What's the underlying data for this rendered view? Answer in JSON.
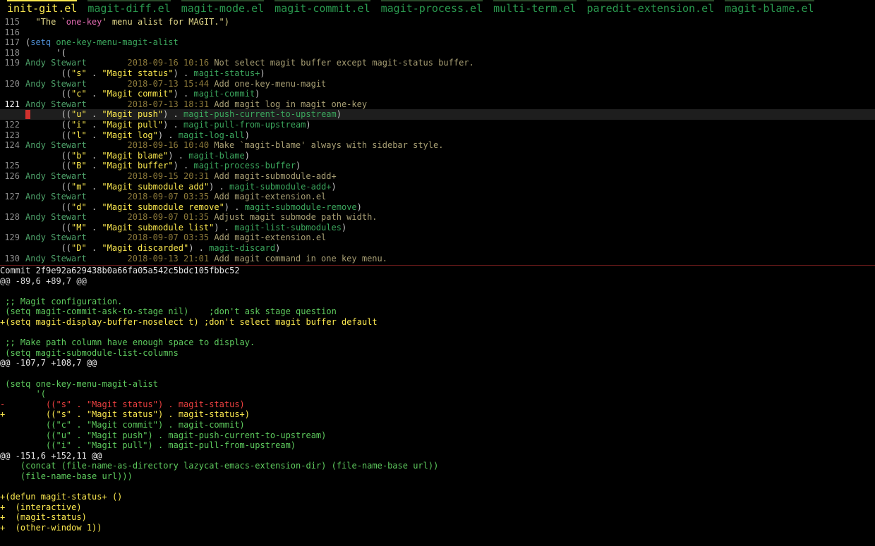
{
  "tabs": [
    {
      "label": "init-git.el",
      "active": true
    },
    {
      "label": "magit-diff.el",
      "active": false
    },
    {
      "label": "magit-mode.el",
      "active": false
    },
    {
      "label": "magit-commit.el",
      "active": false
    },
    {
      "label": "magit-process.el",
      "active": false
    },
    {
      "label": "multi-term.el",
      "active": false
    },
    {
      "label": "paredit-extension.el",
      "active": false
    },
    {
      "label": "magit-blame.el",
      "active": false
    }
  ],
  "blame": {
    "lines": [
      {
        "num": "115",
        "kind": "doc",
        "text": "  \"The `",
        "quoted": "one-key",
        "rest": "' menu alist for MAGIT.\")"
      },
      {
        "num": "116",
        "kind": "blank"
      },
      {
        "num": "117",
        "kind": "setq",
        "open": "(",
        "kw": "setq",
        "name": " one-key-menu-magit-alist"
      },
      {
        "num": "118",
        "kind": "code",
        "text": "      '("
      },
      {
        "num": "119",
        "kind": "blame",
        "author": "Andy Stewart",
        "date": "2018-09-16 10:16",
        "msg": "Not select magit buffer except magit-status buffer."
      },
      {
        "num": "",
        "kind": "entry",
        "key": "\"s\"",
        "label": "\"Magit status\"",
        "fn": "magit-status+"
      },
      {
        "num": "120",
        "kind": "blame",
        "author": "Andy Stewart",
        "date": "2018-07-13 15:44",
        "msg": "Add one-key-menu-magit"
      },
      {
        "num": "",
        "kind": "entry",
        "key": "\"c\"",
        "label": "\"Magit commit\"",
        "fn": "magit-commit"
      },
      {
        "num": "121",
        "kind": "blame",
        "author": "Andy Stewart",
        "date": "2018-07-13 18:31",
        "msg": "Add magit log in magit one-key",
        "current_num": true
      },
      {
        "num": "",
        "kind": "entry",
        "key": "\"u\"",
        "label": "\"Magit push\"",
        "fn": "magit-push-current-to-upstream",
        "current": true
      },
      {
        "num": "122",
        "kind": "entry",
        "key": "\"i\"",
        "label": "\"Magit pull\"",
        "fn": "magit-pull-from-upstream"
      },
      {
        "num": "123",
        "kind": "entry",
        "key": "\"l\"",
        "label": "\"Magit log\"",
        "fn": "magit-log-all"
      },
      {
        "num": "124",
        "kind": "blame",
        "author": "Andy Stewart",
        "date": "2018-09-16 10:40",
        "msg": "Make `magit-blame' always with sidebar style."
      },
      {
        "num": "",
        "kind": "entry",
        "key": "\"b\"",
        "label": "\"Magit blame\"",
        "fn": "magit-blame"
      },
      {
        "num": "125",
        "kind": "entry",
        "key": "\"B\"",
        "label": "\"Magit buffer\"",
        "fn": "magit-process-buffer"
      },
      {
        "num": "126",
        "kind": "blame",
        "author": "Andy Stewart",
        "date": "2018-09-15 20:31",
        "msg": "Add magit-submodule-add+"
      },
      {
        "num": "",
        "kind": "entry",
        "key": "\"m\"",
        "label": "\"Magit submodule add\"",
        "fn": "magit-submodule-add+"
      },
      {
        "num": "127",
        "kind": "blame",
        "author": "Andy Stewart",
        "date": "2018-09-07 03:35",
        "msg": "Add magit-extension.el"
      },
      {
        "num": "",
        "kind": "entry",
        "key": "\"d\"",
        "label": "\"Magit submodule remove\"",
        "fn": "magit-submodule-remove"
      },
      {
        "num": "128",
        "kind": "blame",
        "author": "Andy Stewart",
        "date": "2018-09-07 01:35",
        "msg": "Adjust magit submode path width."
      },
      {
        "num": "",
        "kind": "entry",
        "key": "\"M\"",
        "label": "\"Magit submodule list\"",
        "fn": "magit-list-submodules"
      },
      {
        "num": "129",
        "kind": "blame",
        "author": "Andy Stewart",
        "date": "2018-09-07 03:35",
        "msg": "Add magit-extension.el"
      },
      {
        "num": "",
        "kind": "entry",
        "key": "\"D\"",
        "label": "\"Magit discarded\"",
        "fn": "magit-discard"
      },
      {
        "num": "130",
        "kind": "blame",
        "author": "Andy Stewart",
        "date": "2018-09-13 21:01",
        "msg": "Add magit command in one key menu."
      }
    ]
  },
  "diff": {
    "lines": [
      {
        "type": "head",
        "text": "Commit 2f9e92a629438b0a66fa05a542c5bdc105fbbc52"
      },
      {
        "type": "hunk-first",
        "text": "@@ -89,6 +89,7 @@"
      },
      {
        "type": "ctx",
        "text": ""
      },
      {
        "type": "ctx",
        "text": " ;; Magit configuration."
      },
      {
        "type": "ctx",
        "text": " (setq magit-commit-ask-to-stage nil)    ;don't ask stage question"
      },
      {
        "type": "add",
        "text": "+(setq magit-display-buffer-noselect t) ;don't select magit buffer default"
      },
      {
        "type": "ctx",
        "text": ""
      },
      {
        "type": "ctx",
        "text": " ;; Make path column have enough space to display."
      },
      {
        "type": "ctx",
        "text": " (setq magit-submodule-list-columns"
      },
      {
        "type": "hunk",
        "text": "@@ -107,7 +108,7 @@"
      },
      {
        "type": "ctx",
        "text": ""
      },
      {
        "type": "ctx",
        "text": " (setq one-key-menu-magit-alist"
      },
      {
        "type": "ctx",
        "text": "       '("
      },
      {
        "type": "del",
        "text": "-        ((\"s\" . \"Magit status\") . magit-status)"
      },
      {
        "type": "add",
        "text": "+        ((\"s\" . \"Magit status\") . magit-status+)"
      },
      {
        "type": "ctx",
        "text": "         ((\"c\" . \"Magit commit\") . magit-commit)"
      },
      {
        "type": "ctx",
        "text": "         ((\"u\" . \"Magit push\") . magit-push-current-to-upstream)"
      },
      {
        "type": "ctx",
        "text": "         ((\"i\" . \"Magit pull\") . magit-pull-from-upstream)"
      },
      {
        "type": "hunk",
        "text": "@@ -151,6 +152,11 @@"
      },
      {
        "type": "ctx",
        "text": "    (concat (file-name-as-directory lazycat-emacs-extension-dir) (file-name-base url))"
      },
      {
        "type": "ctx",
        "text": "    (file-name-base url)))"
      },
      {
        "type": "ctx",
        "text": ""
      },
      {
        "type": "add",
        "text": "+(defun magit-status+ ()"
      },
      {
        "type": "add",
        "text": "+  (interactive)"
      },
      {
        "type": "add",
        "text": "+  (magit-status)"
      },
      {
        "type": "add",
        "text": "+  (other-window 1))"
      }
    ]
  },
  "colors": {
    "background": "#000000",
    "tab_active": "#fce94f",
    "tab_inactive": "#2a9a4f",
    "diff_added": "#fce94f",
    "diff_removed": "#ef4040",
    "diff_context": "#5ecb5e",
    "cursor": "#d0312d"
  }
}
